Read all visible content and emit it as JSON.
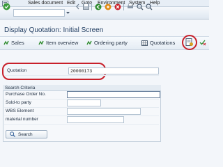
{
  "menu": {
    "sales_document": "Sales document",
    "edit": "Edit",
    "goto": "Goto",
    "environment": "Environment",
    "system": "System",
    "help": "Help"
  },
  "toolbar": {
    "command_field_value": "",
    "icons": [
      "sap-logo-icon",
      "save-icon",
      "back-icon",
      "exit-icon",
      "cancel-icon",
      "print-icon",
      "find-icon",
      "find-next-icon"
    ]
  },
  "page": {
    "title": "Display Quotation: Initial Screen"
  },
  "app_toolbar": {
    "sales": "Sales",
    "item_overview": "Item overview",
    "ordering_party": "Ordering party",
    "quotations": "Quotations"
  },
  "form": {
    "quotation_label": "Quotation",
    "quotation_value": "20000173"
  },
  "search_criteria": {
    "title": "Search Criteria",
    "fields": [
      {
        "label": "Purchase Order No.",
        "value": ""
      },
      {
        "label": "Sold-to party",
        "value": ""
      },
      {
        "label": "WBS Element",
        "value": ""
      },
      {
        "label": "material number",
        "value": ""
      }
    ],
    "search_button": "Search"
  },
  "colors": {
    "highlight_red": "#c8202a",
    "title_blue": "#233f63",
    "icon_green": "#2e8b2e"
  }
}
